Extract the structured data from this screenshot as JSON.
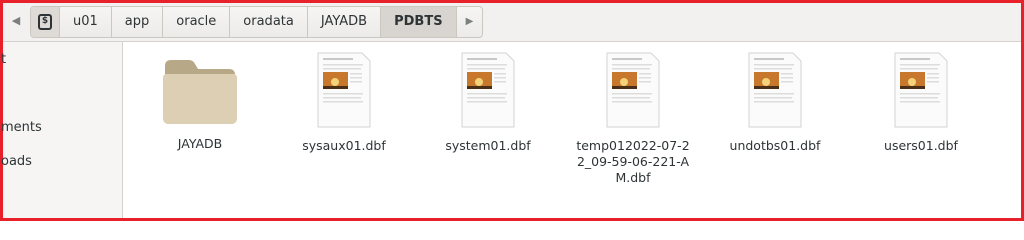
{
  "pathbar": {
    "crumbs": [
      "u01",
      "app",
      "oracle",
      "oradata",
      "JAYADB",
      "PDBTS"
    ],
    "active": "PDBTS"
  },
  "sidebar": {
    "items": [
      "t",
      "ments",
      "oads"
    ]
  },
  "files": [
    {
      "name": "JAYADB",
      "icon": "folder-icon"
    },
    {
      "name": "sysaux01.dbf",
      "icon": "document-thumbnail-icon"
    },
    {
      "name": "system01.dbf",
      "icon": "document-thumbnail-icon"
    },
    {
      "name": "temp012022-07-22_09-59-06-221-AM.dbf",
      "icon": "document-thumbnail-icon"
    },
    {
      "name": "undotbs01.dbf",
      "icon": "document-thumbnail-icon"
    },
    {
      "name": "users01.dbf",
      "icon": "document-thumbnail-icon"
    }
  ],
  "colors": {
    "highlight_border": "#e8202a",
    "folder": "#d9c9a6"
  }
}
